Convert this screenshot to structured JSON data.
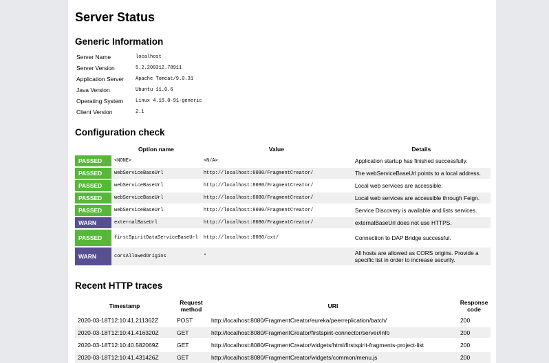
{
  "page": {
    "title": "Server Status"
  },
  "generic": {
    "heading": "Generic Information",
    "rows": [
      {
        "key": "Server Name",
        "value": "localhost"
      },
      {
        "key": "Server Version",
        "value": "5.2.200312.78911"
      },
      {
        "key": "Application Server",
        "value": "Apache Tomcat/9.0.31"
      },
      {
        "key": "Java Version",
        "value": "Ubuntu 11.0.6"
      },
      {
        "key": "Operating System",
        "value": "Linux 4.15.0-91-generic"
      },
      {
        "key": "Client Version",
        "value": "2.1"
      }
    ]
  },
  "config": {
    "heading": "Configuration check",
    "columns": [
      "",
      "Option name",
      "Value",
      "Details"
    ],
    "rows": [
      {
        "status": "PASSED",
        "option": "<NONE>",
        "value": "<N/A>",
        "details": "Application startup has finished successfully."
      },
      {
        "status": "PASSED",
        "option": "webServiceBaseUrl",
        "value": "http://localhost:8080/FragmentCreator/",
        "details": "The webServiceBaseUrl points to a local address."
      },
      {
        "status": "PASSED",
        "option": "webServiceBaseUrl",
        "value": "http://localhost:8080/FragmentCreator/",
        "details": "Local web services are accessible."
      },
      {
        "status": "PASSED",
        "option": "webServiceBaseUrl",
        "value": "http://localhost:8080/FragmentCreator/",
        "details": "Local web services are accessible through Feign."
      },
      {
        "status": "PASSED",
        "option": "webServiceBaseUrl",
        "value": "http://localhost:8080/FragmentCreator/",
        "details": "Service Discovery is available and lists services."
      },
      {
        "status": "WARN",
        "option": "externalBaseUrl",
        "value": "http://localhost:8080/FragmentCreator/",
        "details": "externalBaseUrl does not use HTTPS."
      },
      {
        "status": "PASSED",
        "option": "firstSpiritDataServiceBaseUrl",
        "value": "http://localhost:8080/cxt/",
        "details": "Connection to DAP Bridge successful."
      },
      {
        "status": "WARN",
        "option": "corsAllowedOrigins",
        "value": "*",
        "details": "All hosts are allowed as CORS origins. Provide a specific list in order to increase security."
      }
    ],
    "colors": {
      "passed": "#56b83a",
      "warn": "#574f92"
    }
  },
  "traces": {
    "heading": "Recent HTTP traces",
    "columns": [
      "Timestamp",
      "Request method",
      "URI",
      "Response code"
    ],
    "rows": [
      {
        "timestamp": "2020-03-18T12:10:41.211362Z",
        "method": "POST",
        "uri": "http://localhost:8080/FragmentCreator/eureka/peerreplication/batch/",
        "code": "200"
      },
      {
        "timestamp": "2020-03-18T12:10:41.416320Z",
        "method": "GET",
        "uri": "http://localhost:8080/FragmentCreator/firstspirit-connector/server/info",
        "code": "200"
      },
      {
        "timestamp": "2020-03-18T12:10:40.582069Z",
        "method": "GET",
        "uri": "http://localhost:8080/FragmentCreator/widgets/html/firstspirit-fragments-project-list",
        "code": "200"
      },
      {
        "timestamp": "2020-03-18T12:10:41.431426Z",
        "method": "GET",
        "uri": "http://localhost:8080/FragmentCreator/widgets/common/menu.js",
        "code": "200"
      }
    ]
  }
}
